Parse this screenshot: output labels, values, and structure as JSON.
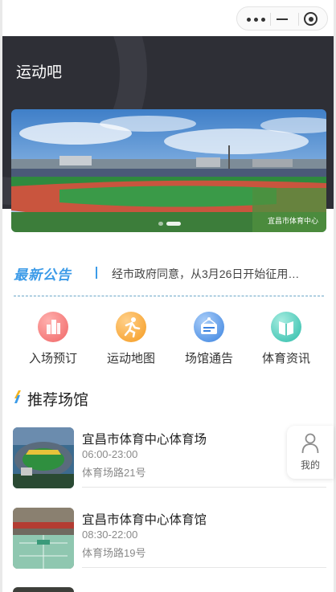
{
  "nav": {
    "capsule": {
      "more_icon": "more-dots-icon",
      "minimize_icon": "minimize-icon",
      "close_icon": "target-close-icon"
    }
  },
  "header": {
    "title": "运动吧",
    "background_color": "#2e2f36"
  },
  "banner": {
    "caption": "宜昌市体育中心",
    "slide_count": 2,
    "active_slide": 2
  },
  "notice": {
    "tag": "最新公告",
    "text": "经市政府同意，从3月26日开始征用…",
    "accent_color": "#3c9be8"
  },
  "quick_entries": [
    {
      "label": "入场预订",
      "icon": "building-icon",
      "color": "#f26d6d"
    },
    {
      "label": "运动地图",
      "icon": "runner-icon",
      "color": "#f5a623"
    },
    {
      "label": "场馆通告",
      "icon": "notice-board-icon",
      "color": "#3b8ee8"
    },
    {
      "label": "体育资讯",
      "icon": "book-icon",
      "color": "#3cc4b4"
    }
  ],
  "recommend": {
    "title": "推荐场馆",
    "venues": [
      {
        "name": "宜昌市体育中心体育场",
        "hours": "06:00-23:00",
        "address": "体育场路21号",
        "thumb": "stadium-photo"
      },
      {
        "name": "宜昌市体育中心体育馆",
        "hours": "08:30-22:00",
        "address": "体育场路19号",
        "thumb": "gymnasium-photo"
      }
    ]
  },
  "floating": {
    "mine_label": "我的",
    "mine_icon": "person-icon"
  }
}
